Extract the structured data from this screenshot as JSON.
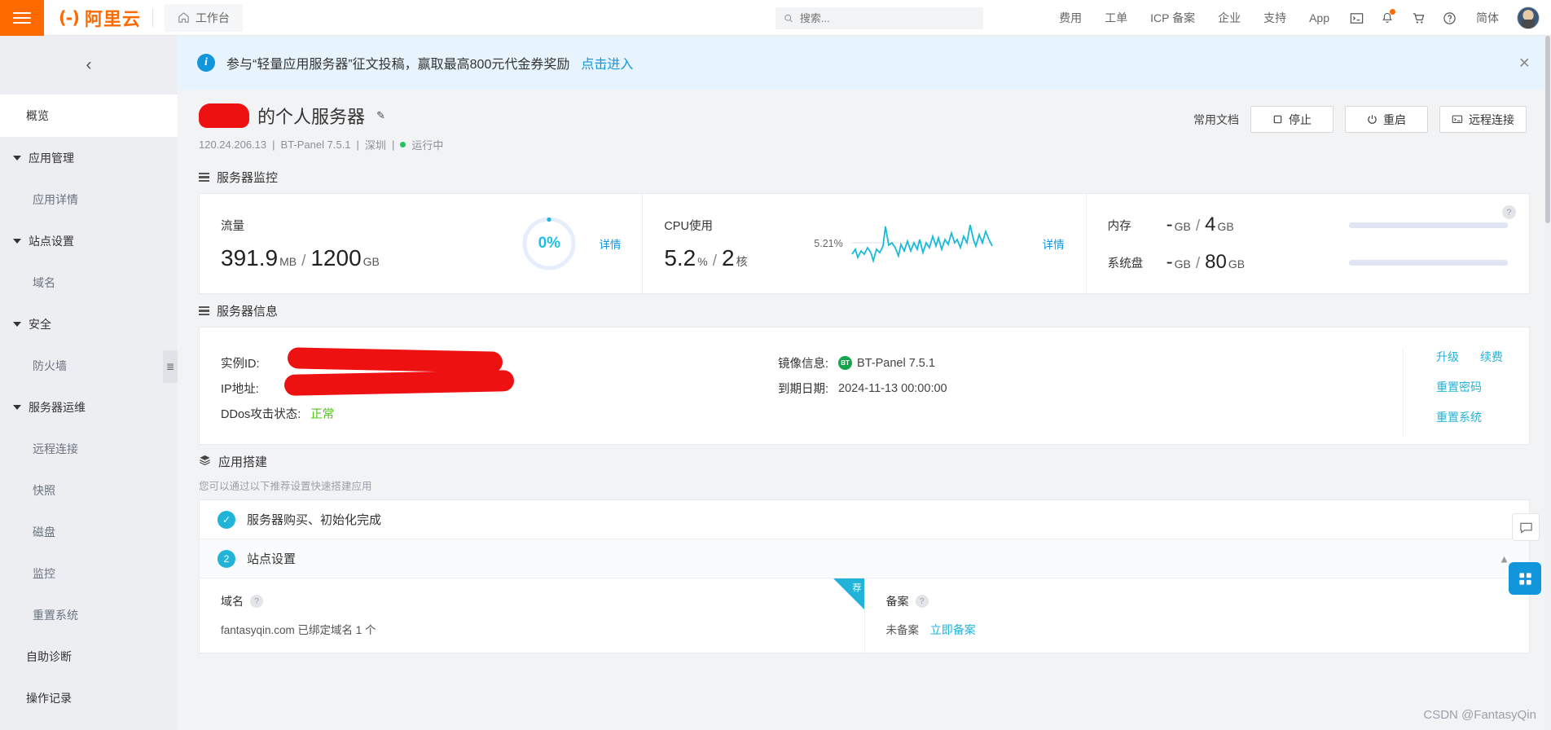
{
  "topbar": {
    "menu_icon": "hamburger-icon",
    "brand_mark": "(-)",
    "brand_text": "阿里云",
    "workbench_label": "工作台",
    "home_icon": "home-icon",
    "search": {
      "placeholder": "搜索...",
      "value": "",
      "icon": "search-icon"
    },
    "nav_links": [
      "费用",
      "工单",
      "ICP 备案",
      "企业",
      "支持",
      "App"
    ],
    "icons": [
      "terminal-icon",
      "bell-icon",
      "cart-icon",
      "help-icon"
    ],
    "language": "简体",
    "avatar": "user-avatar"
  },
  "sidebar": {
    "collapse_icon": "chevron-left-icon",
    "overview": "概览",
    "groups": [
      {
        "label": "应用管理",
        "children": [
          "应用详情"
        ]
      },
      {
        "label": "站点设置",
        "children": [
          "域名"
        ]
      },
      {
        "label": "安全",
        "children": [
          "防火墙"
        ]
      },
      {
        "label": "服务器运维",
        "children": [
          "远程连接",
          "快照",
          "磁盘",
          "监控",
          "重置系统"
        ]
      }
    ],
    "items": [
      "自助诊断",
      "操作记录"
    ],
    "handle_icon": "panel-toggle-icon"
  },
  "banner": {
    "icon": "info-icon",
    "text": "参与“轻量应用服务器”征文投稿，赢取最高800元代金券奖励",
    "link": "点击进入",
    "close_icon": "close-icon"
  },
  "page_head": {
    "title_suffix": "的个人服务器",
    "redacted_name": "",
    "edit_icon": "edit-pencil-icon",
    "meta": {
      "ip": "120.24.206.13",
      "image": "BT-Panel 7.5.1",
      "region": "深圳",
      "status": "运行中"
    },
    "doc_link": "常用文档",
    "buttons": [
      {
        "label": "停止",
        "icon": "stop-icon"
      },
      {
        "label": "重启",
        "icon": "power-icon"
      },
      {
        "label": "远程连接",
        "icon": "remote-desktop-icon"
      }
    ]
  },
  "monitor": {
    "section_title": "服务器监控",
    "section_icon": "server-icon",
    "traffic": {
      "label": "流量",
      "used": "391.9",
      "used_unit": "MB",
      "total": "1200",
      "total_unit": "GB",
      "percent": "0%",
      "percent_value": 0,
      "detail": "详情"
    },
    "cpu": {
      "label": "CPU使用",
      "value": "5.2",
      "value_unit": "%",
      "cores": "2",
      "cores_unit": "核",
      "spark_label": "5.21%",
      "detail": "详情"
    },
    "memory": {
      "label": "内存",
      "used": "-",
      "used_unit": "GB",
      "total": "4",
      "total_unit": "GB"
    },
    "disk": {
      "label": "系统盘",
      "used": "-",
      "used_unit": "GB",
      "total": "80",
      "total_unit": "GB"
    },
    "help_icon": "help-circle-icon"
  },
  "server_info": {
    "section_title": "服务器信息",
    "section_icon": "server-icon",
    "instance_id_label": "实例ID:",
    "instance_id_value": "",
    "ip_label": "IP地址:",
    "ip_value": "",
    "ddos_label": "DDos攻击状态:",
    "ddos_value": "正常",
    "image_label": "镜像信息:",
    "image_value": "BT-Panel 7.5.1",
    "image_badge": "BT",
    "expiry_label": "到期日期:",
    "expiry_value": "2024-11-13 00:00:00",
    "links_row1": [
      "升级",
      "续费"
    ],
    "links_row2": "重置密码",
    "links_row3": "重置系统"
  },
  "app_setup": {
    "section_title": "应用搭建",
    "section_icon": "layers-icon",
    "subtitle": "您可以通过以下推荐设置快速搭建应用",
    "steps": [
      {
        "badge": "✓",
        "label": "服务器购买、初始化完成",
        "state": "done"
      },
      {
        "badge": "2",
        "label": "站点设置",
        "state": "active"
      }
    ],
    "collapse_icon": "chevron-up-icon",
    "panels": [
      {
        "label": "域名",
        "help_icon": "help-circle-icon",
        "ribbon": "荐",
        "body": "fantasyqin.com 已绑定域名 1 个"
      },
      {
        "label": "备案",
        "help_icon": "help-circle-icon",
        "ribbon": "",
        "body": "未备案",
        "action": "立即备案"
      }
    ]
  },
  "floating": {
    "chat_icon": "chat-icon",
    "apps_icon": "grid-apps-icon"
  },
  "watermark": "CSDN @FantasyQin",
  "colors": {
    "brand_orange": "#ff6a00",
    "accent_blue": "#1296db",
    "cyan": "#22b3d8",
    "green": "#52c41a",
    "redact_red": "#ee1111"
  }
}
